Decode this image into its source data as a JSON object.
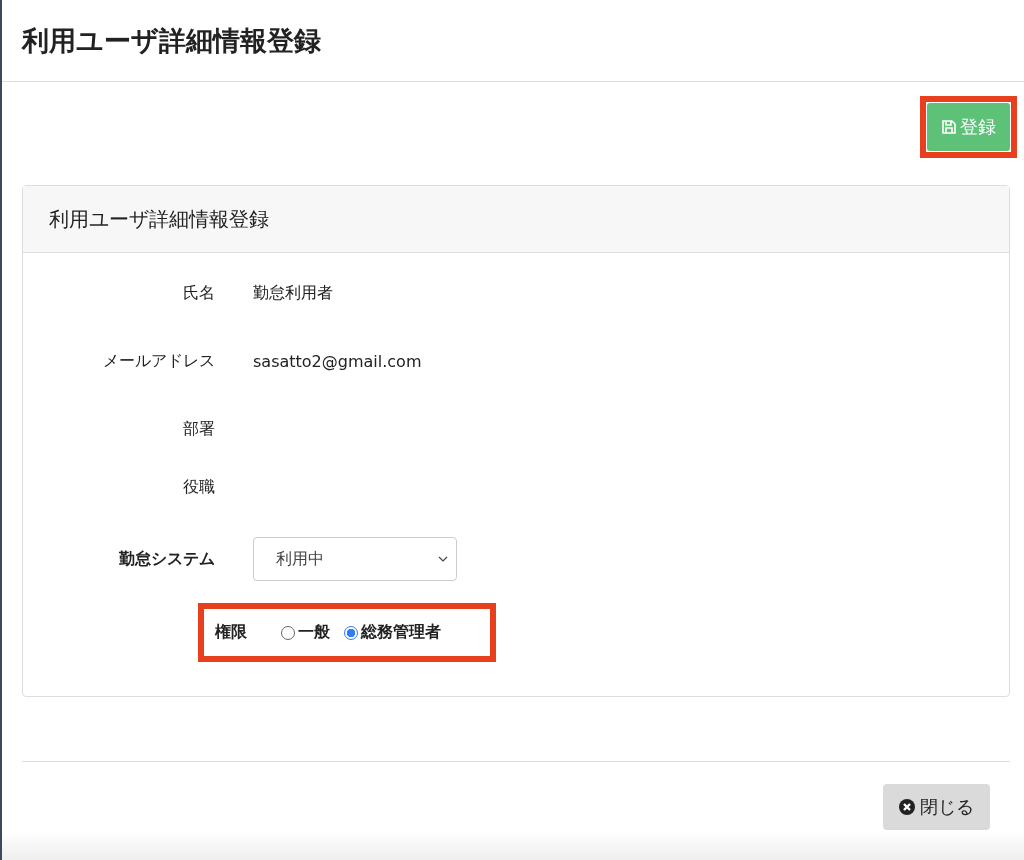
{
  "page": {
    "title": "利用ユーザ詳細情報登録"
  },
  "save_button": {
    "label": "登録",
    "highlighted": true
  },
  "card": {
    "title": "利用ユーザ詳細情報登録",
    "fields": [
      {
        "kind": "text",
        "label": "氏名",
        "bold": false,
        "value": "勤怠利用者"
      },
      {
        "kind": "text",
        "label": "メールアドレス",
        "bold": false,
        "value": "sasatto2@gmail.com"
      },
      {
        "kind": "text",
        "label": "部署",
        "bold": false
      },
      {
        "kind": "text",
        "label": "役職",
        "bold": false
      },
      {
        "kind": "select",
        "label": "勤怠システム",
        "bold": true,
        "value": "利用中"
      },
      {
        "kind": "radio",
        "label": "権限",
        "bold": true,
        "highlighted": true,
        "options": [
          {
            "label": "一般",
            "selected": false
          },
          {
            "label": "総務管理者",
            "selected": true
          }
        ]
      }
    ]
  },
  "close_button": {
    "label": "閉じる"
  }
}
